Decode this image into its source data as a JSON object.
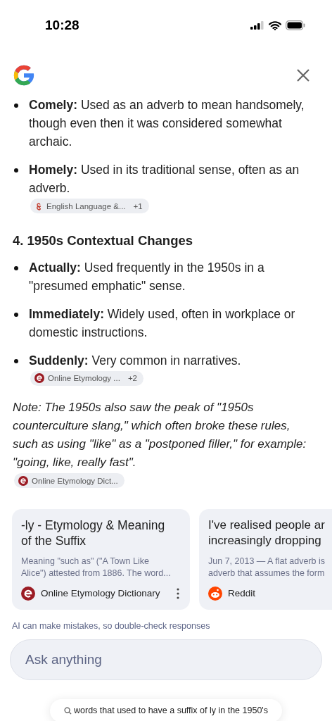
{
  "status_bar": {
    "time": "10:28"
  },
  "bullets_top": [
    {
      "term": "Comely:",
      "text": "Used as an adverb to mean handsomely, though even then it was considered somewhat archaic."
    },
    {
      "term": "Homely:",
      "text": "Used in its traditional sense, often as an adverb.",
      "chip": {
        "kind": "ampersand",
        "label": "English Language &...",
        "count": "+1"
      }
    }
  ],
  "heading": "4. 1950s Contextual Changes",
  "bullets": [
    {
      "term": "Actually:",
      "text": "Used frequently in the 1950s in a \"presumed emphatic\" sense."
    },
    {
      "term": "Immediately:",
      "text": "Widely used, often in workplace or domestic instructions."
    },
    {
      "term": "Suddenly:",
      "text": "Very common in narratives.",
      "chip": {
        "kind": "etymology",
        "label": "Online Etymology ...",
        "count": "+2"
      }
    }
  ],
  "note": {
    "text": "Note: The 1950s also saw the peak of \"1950s counterculture slang,\" which often broke these rules, such as using \"like\" as a \"postponed filler,\" for example: \"going, like, really fast\".",
    "chip": {
      "kind": "etymology",
      "label": "Online Etymology Dict..."
    }
  },
  "cards": [
    {
      "title": "-ly - Etymology & Meaning of the Suffix",
      "snippet": "Meaning \"such as\" (\"A Town Like Alice\") attested from 1886. The word...",
      "source": "Online Etymology Dictionary",
      "kind": "etymology",
      "menu": true
    },
    {
      "title": "I've realised people ar increasingly dropping",
      "snippet": "Jun 7, 2013 — A flat adverb is adverb that assumes the form",
      "source": "Reddit",
      "kind": "reddit",
      "menu": false
    }
  ],
  "disclaimer": "AI can make mistakes, so double-check responses",
  "ask": {
    "placeholder": "Ask anything"
  },
  "query": "words that used to have a suffix of ly in the 1950's"
}
